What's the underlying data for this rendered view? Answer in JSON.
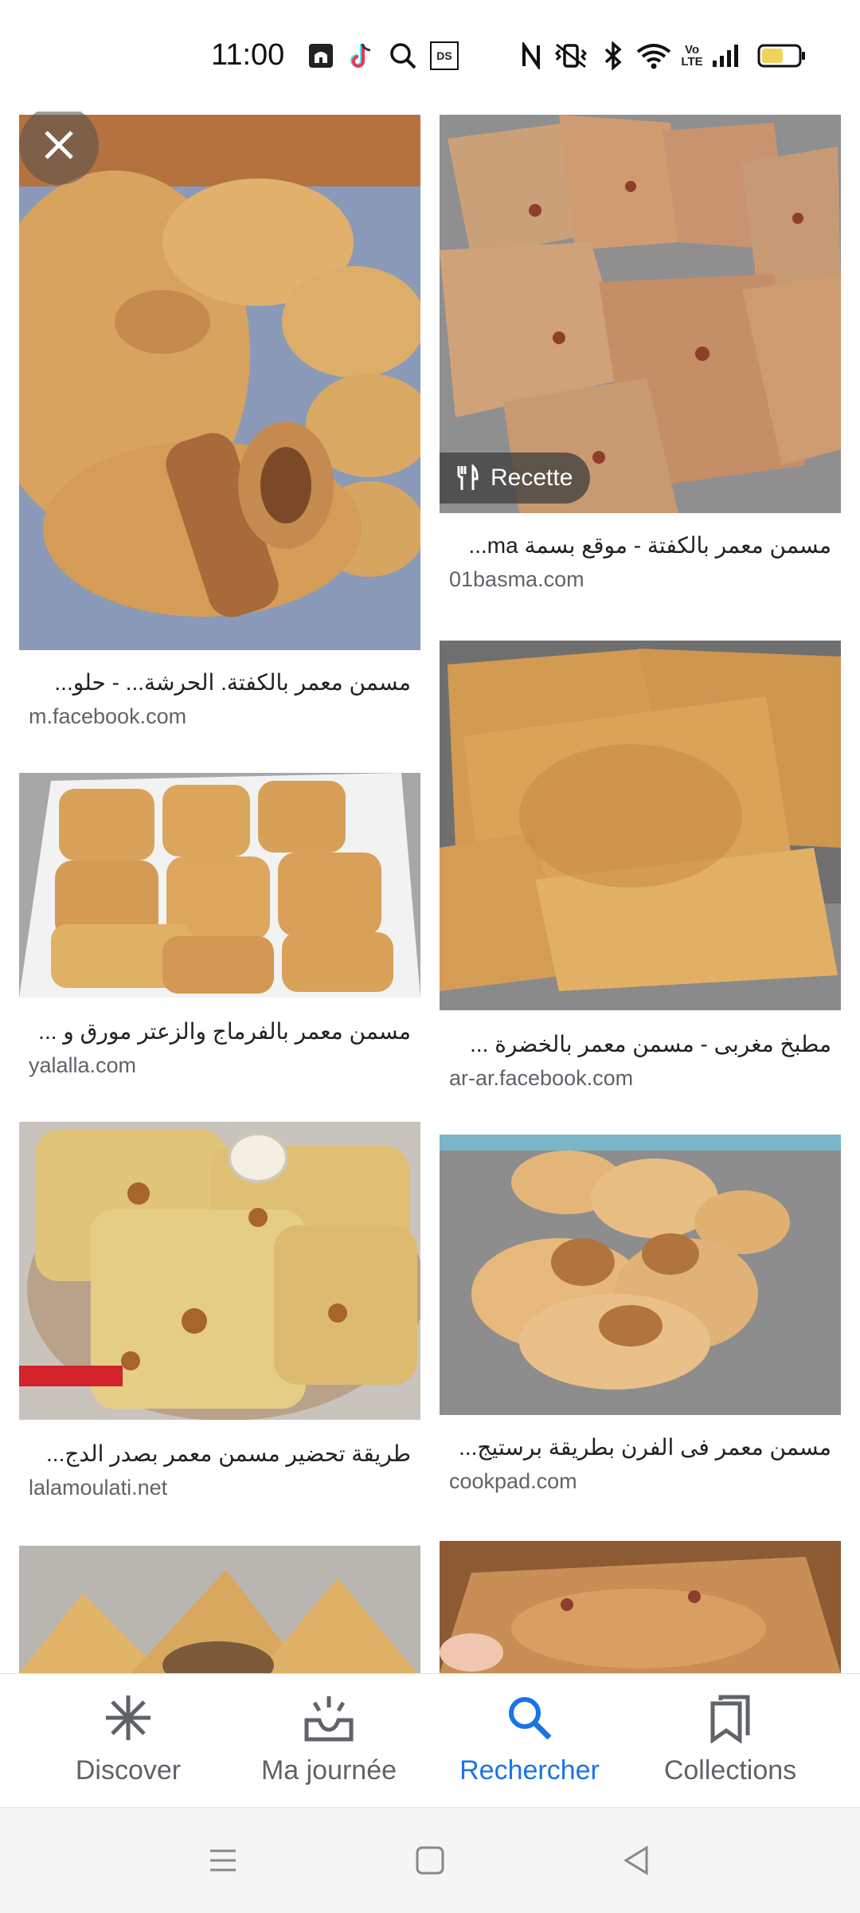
{
  "status_bar": {
    "time": "11:00",
    "icons": [
      "mosque-icon",
      "tiktok-icon",
      "search-icon",
      "ds-icon",
      "nfc-icon",
      "vibrate-icon",
      "bluetooth-icon",
      "wifi-icon",
      "volte-icon",
      "signal-icon",
      "battery-icon"
    ],
    "ds_text": "DS",
    "volte_text": "Vo LTE",
    "battery_level": 0.6
  },
  "results": [
    {
      "title": "مسمن معمر بالكفتة. الحرشة... - حلو...",
      "source": "m.facebook.com"
    },
    {
      "title": "مسمن معمر بالكفتة - موقع بسمة ma...",
      "source": "01basma.com",
      "badge": "Recette"
    },
    {
      "title": "مسمن معمر بالفرماج والزعتر مورق و ...",
      "source": "yalalla.com"
    },
    {
      "title": "مطبخ مغربى - مسمن معمر بالخضرة ...",
      "source": "ar-ar.facebook.com"
    },
    {
      "title": "طريقة تحضير مسمن معمر بصدر الدج...",
      "source": "lalamoulati.net"
    },
    {
      "title": "مسمن معمر فى الفرن بطريقة برستيج...",
      "source": "cookpad.com"
    },
    {
      "title": "",
      "source": ""
    },
    {
      "title": "",
      "source": ""
    }
  ],
  "bottom_nav": [
    {
      "label": "Discover",
      "icon": "asterisk-icon"
    },
    {
      "label": "Ma journée",
      "icon": "inbox-sun-icon"
    },
    {
      "label": "Rechercher",
      "icon": "search-icon",
      "active": true
    },
    {
      "label": "Collections",
      "icon": "bookmarks-icon"
    }
  ],
  "colors": {
    "active": "#1a73e8",
    "inactive": "#5f6368",
    "battery_fill": "#f2d25e"
  }
}
